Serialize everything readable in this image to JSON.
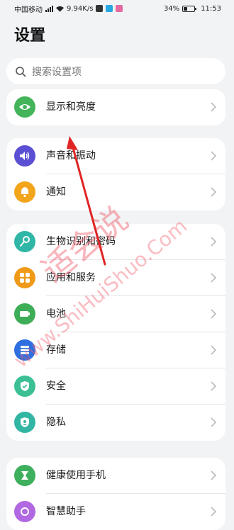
{
  "status_bar": {
    "carrier": "中国移动",
    "net_speed": "9.94K/s",
    "battery": "34%",
    "battery_level": 0.34,
    "time": "11:53"
  },
  "page": {
    "title": "设置"
  },
  "search": {
    "placeholder": "搜索设置项"
  },
  "groups": [
    {
      "items": [
        {
          "label": "显示和亮度",
          "icon": "eye-icon",
          "color": "#43b45a"
        }
      ]
    },
    {
      "items": [
        {
          "label": "声音和振动",
          "icon": "speaker-icon",
          "color": "#5b4fd3"
        },
        {
          "label": "通知",
          "icon": "bell-icon",
          "color": "#f2a51b"
        }
      ]
    },
    {
      "items": [
        {
          "label": "生物识别和密码",
          "icon": "key-icon",
          "color": "#2fb6a6"
        },
        {
          "label": "应用和服务",
          "icon": "apps-icon",
          "color": "#f09a1a"
        },
        {
          "label": "电池",
          "icon": "battery-icon",
          "color": "#3dae57"
        },
        {
          "label": "存储",
          "icon": "storage-icon",
          "color": "#2f6fe0"
        },
        {
          "label": "安全",
          "icon": "shield-icon",
          "color": "#3cbf95"
        },
        {
          "label": "隐私",
          "icon": "privacy-icon",
          "color": "#33b5a4"
        }
      ]
    },
    {
      "items": [
        {
          "label": "健康使用手机",
          "icon": "hourglass-icon",
          "color": "#3eaf5c"
        },
        {
          "label": "智慧助手",
          "icon": "assistant-icon",
          "color": "#b069e0"
        }
      ]
    }
  ],
  "watermark": {
    "text": "适会说",
    "url_text": "www.ShiHuiShuo.Com"
  }
}
